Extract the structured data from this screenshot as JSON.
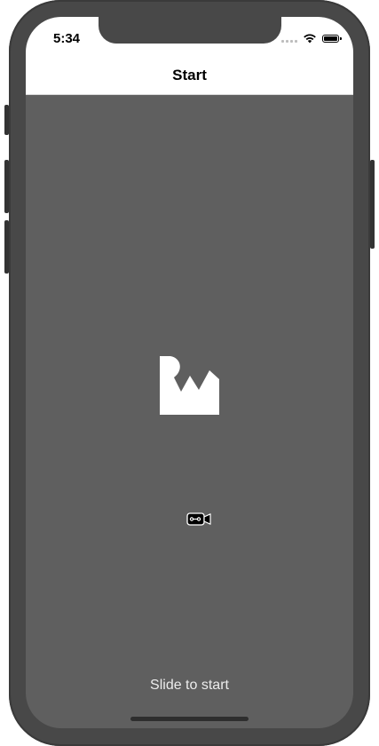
{
  "status_bar": {
    "time": "5:34",
    "icons": [
      "cellular-signal-icon",
      "wifi-icon",
      "battery-icon"
    ]
  },
  "nav_bar": {
    "title": "Start"
  },
  "main": {
    "logo_icon": "rw-logo-icon",
    "camera_icon": "video-camera-icon",
    "slide_label": "Slide to start"
  },
  "colors": {
    "device_frame": "#484848",
    "screen_background": "#5f5f5f",
    "nav_background": "#ffffff",
    "slide_text": "#ececec"
  }
}
